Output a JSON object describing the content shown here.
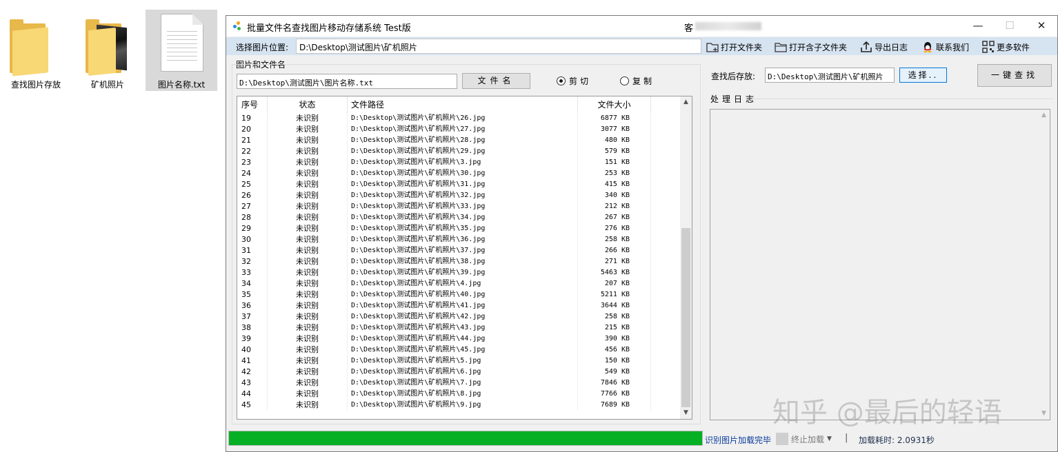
{
  "desktop": {
    "icons": [
      {
        "label": "查找图片存放"
      },
      {
        "label": "矿机照片"
      },
      {
        "label": "图片名称.txt"
      }
    ]
  },
  "window": {
    "title": "批量文件名查找图片移动存储系统 Test版",
    "title_right": "客"
  },
  "toolbar": {
    "label": "选择图片位置:",
    "path": "D:\\Desktop\\测试图片\\矿机照片",
    "buttons": [
      {
        "label": "打开文件夹",
        "icon": "open-folder-icon"
      },
      {
        "label": "打开含子文件夹",
        "icon": "open-subfolder-icon"
      },
      {
        "label": "导出日志",
        "icon": "export-icon"
      },
      {
        "label": "联系我们",
        "icon": "qq-penguin-icon"
      },
      {
        "label": "更多软件",
        "icon": "qrcode-icon"
      }
    ]
  },
  "left_panel": {
    "group_label": "图片和文件名",
    "file_path": "D:\\Desktop\\测试图片\\图片名称.txt",
    "file_button": "文件名",
    "radio_cut": "剪切",
    "radio_copy": "复制",
    "radio_selected": "cut"
  },
  "table": {
    "columns": [
      "序号",
      "状态",
      "文件路径",
      "文件大小"
    ],
    "rows": [
      {
        "no": "19",
        "status": "未识别",
        "path": "D:\\Desktop\\测试图片\\矿机照片\\26.jpg",
        "size": "6877 KB"
      },
      {
        "no": "20",
        "status": "未识别",
        "path": "D:\\Desktop\\测试图片\\矿机照片\\27.jpg",
        "size": "3077 KB"
      },
      {
        "no": "21",
        "status": "未识别",
        "path": "D:\\Desktop\\测试图片\\矿机照片\\28.jpg",
        "size": "480 KB"
      },
      {
        "no": "22",
        "status": "未识别",
        "path": "D:\\Desktop\\测试图片\\矿机照片\\29.jpg",
        "size": "579 KB"
      },
      {
        "no": "23",
        "status": "未识别",
        "path": "D:\\Desktop\\测试图片\\矿机照片\\3.jpg",
        "size": "151 KB"
      },
      {
        "no": "24",
        "status": "未识别",
        "path": "D:\\Desktop\\测试图片\\矿机照片\\30.jpg",
        "size": "253 KB"
      },
      {
        "no": "25",
        "status": "未识别",
        "path": "D:\\Desktop\\测试图片\\矿机照片\\31.jpg",
        "size": "415 KB"
      },
      {
        "no": "26",
        "status": "未识别",
        "path": "D:\\Desktop\\测试图片\\矿机照片\\32.jpg",
        "size": "340 KB"
      },
      {
        "no": "27",
        "status": "未识别",
        "path": "D:\\Desktop\\测试图片\\矿机照片\\33.jpg",
        "size": "212 KB"
      },
      {
        "no": "28",
        "status": "未识别",
        "path": "D:\\Desktop\\测试图片\\矿机照片\\34.jpg",
        "size": "267 KB"
      },
      {
        "no": "29",
        "status": "未识别",
        "path": "D:\\Desktop\\测试图片\\矿机照片\\35.jpg",
        "size": "276 KB"
      },
      {
        "no": "30",
        "status": "未识别",
        "path": "D:\\Desktop\\测试图片\\矿机照片\\36.jpg",
        "size": "258 KB"
      },
      {
        "no": "31",
        "status": "未识别",
        "path": "D:\\Desktop\\测试图片\\矿机照片\\37.jpg",
        "size": "266 KB"
      },
      {
        "no": "32",
        "status": "未识别",
        "path": "D:\\Desktop\\测试图片\\矿机照片\\38.jpg",
        "size": "271 KB"
      },
      {
        "no": "33",
        "status": "未识别",
        "path": "D:\\Desktop\\测试图片\\矿机照片\\39.jpg",
        "size": "5463 KB"
      },
      {
        "no": "34",
        "status": "未识别",
        "path": "D:\\Desktop\\测试图片\\矿机照片\\4.jpg",
        "size": "207 KB"
      },
      {
        "no": "35",
        "status": "未识别",
        "path": "D:\\Desktop\\测试图片\\矿机照片\\40.jpg",
        "size": "5211 KB"
      },
      {
        "no": "36",
        "status": "未识别",
        "path": "D:\\Desktop\\测试图片\\矿机照片\\41.jpg",
        "size": "3644 KB"
      },
      {
        "no": "37",
        "status": "未识别",
        "path": "D:\\Desktop\\测试图片\\矿机照片\\42.jpg",
        "size": "258 KB"
      },
      {
        "no": "38",
        "status": "未识别",
        "path": "D:\\Desktop\\测试图片\\矿机照片\\43.jpg",
        "size": "215 KB"
      },
      {
        "no": "39",
        "status": "未识别",
        "path": "D:\\Desktop\\测试图片\\矿机照片\\44.jpg",
        "size": "390 KB"
      },
      {
        "no": "40",
        "status": "未识别",
        "path": "D:\\Desktop\\测试图片\\矿机照片\\45.jpg",
        "size": "456 KB"
      },
      {
        "no": "41",
        "status": "未识别",
        "path": "D:\\Desktop\\测试图片\\矿机照片\\5.jpg",
        "size": "150 KB"
      },
      {
        "no": "42",
        "status": "未识别",
        "path": "D:\\Desktop\\测试图片\\矿机照片\\6.jpg",
        "size": "549 KB"
      },
      {
        "no": "43",
        "status": "未识别",
        "path": "D:\\Desktop\\测试图片\\矿机照片\\7.jpg",
        "size": "7846 KB"
      },
      {
        "no": "44",
        "status": "未识别",
        "path": "D:\\Desktop\\测试图片\\矿机照片\\8.jpg",
        "size": "7766 KB"
      },
      {
        "no": "45",
        "status": "未识别",
        "path": "D:\\Desktop\\测试图片\\矿机照片\\9.jpg",
        "size": "7689 KB"
      }
    ]
  },
  "right_panel": {
    "save_label": "查找后存放:",
    "save_path": "D:\\Desktop\\测试图片\\矿机照片",
    "choose_button": "选择..",
    "search_button": "一键查找",
    "log_label": "处理日志"
  },
  "status": {
    "progress": 1.0,
    "message": "识别图片加载完毕",
    "stop_label": "终止加载",
    "separator": "|",
    "load_time": "加载耗时: 2.0931秒"
  },
  "watermark": "知乎 @最后的轻语",
  "colors": {
    "toolbar_bg": "#d6e3f1",
    "progress_green": "#06b025",
    "status_blue": "#0b3c9c",
    "load_time_text": "#1f2f4f"
  }
}
